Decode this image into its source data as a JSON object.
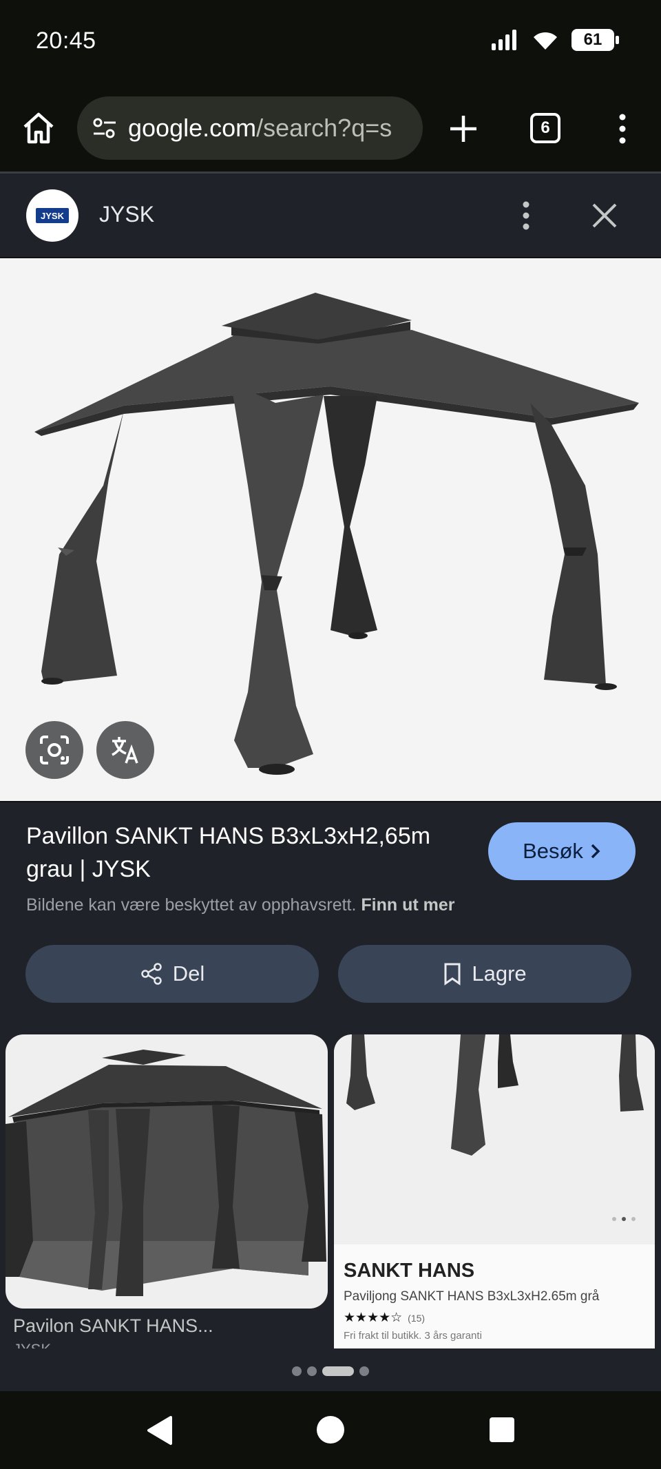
{
  "status_bar": {
    "time": "20:45",
    "battery": "61",
    "icons": [
      "signal-icon",
      "wifi-icon",
      "battery-icon"
    ]
  },
  "browser": {
    "url_host": "google.com",
    "url_path": "/search?q=s",
    "tab_count": "6"
  },
  "source": {
    "logo_text": "JYSK",
    "name": "JYSK"
  },
  "main_image": {
    "alt": "Pavillon SANKT HANS"
  },
  "result": {
    "title": "Pavillon SANKT HANS B3xL3xH2,65m grau | JYSK",
    "visit_label": "Besøk",
    "copyright": "Bildene kan være beskyttet av opphavsrett.",
    "learn_more": "Finn ut mer"
  },
  "actions": {
    "share_label": "Del",
    "save_label": "Lagre"
  },
  "related": [
    {
      "title": "Pavilon SANKT HANS...",
      "source": "JYSK"
    },
    {
      "product_title": "SANKT HANS",
      "product_sub": "Paviljong SANKT HANS B3xL3xH2.65m grå",
      "rating_count": "(15)",
      "extra": "Fri frakt til butikk. 3 års garanti"
    }
  ],
  "colors": {
    "accent": "#8ab4f8",
    "background": "#1f2229",
    "button": "#394457"
  }
}
